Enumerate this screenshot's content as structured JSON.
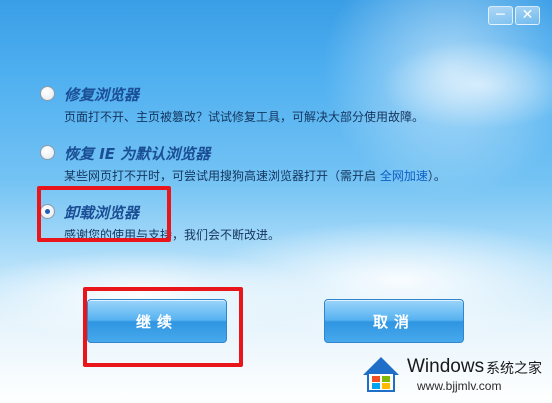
{
  "window_controls": {
    "minimize": "─",
    "close": "✕"
  },
  "options": [
    {
      "title": "修复浏览器",
      "desc": "页面打不开、主页被篡改？试试修复工具，可解决大部分使用故障。",
      "checked": false
    },
    {
      "title": "恢复 IE 为默认浏览器",
      "desc_before": "某些网页打不开时，可尝试用搜狗高速浏览器打开（需开启 ",
      "desc_link": "全网加速",
      "desc_after": "）。",
      "checked": false
    },
    {
      "title": "卸载浏览器",
      "desc": "感谢您的使用与支持，我们会不断改进。",
      "checked": true
    }
  ],
  "buttons": {
    "continue": "继续",
    "cancel": "取消"
  },
  "watermark": {
    "brand": "Windows",
    "brand_cn": "系统之家",
    "url": "www.bjjmlv.com"
  },
  "colors": {
    "highlight": "#e8151a",
    "title": "#1b4f95",
    "link": "#0f5fc4"
  }
}
